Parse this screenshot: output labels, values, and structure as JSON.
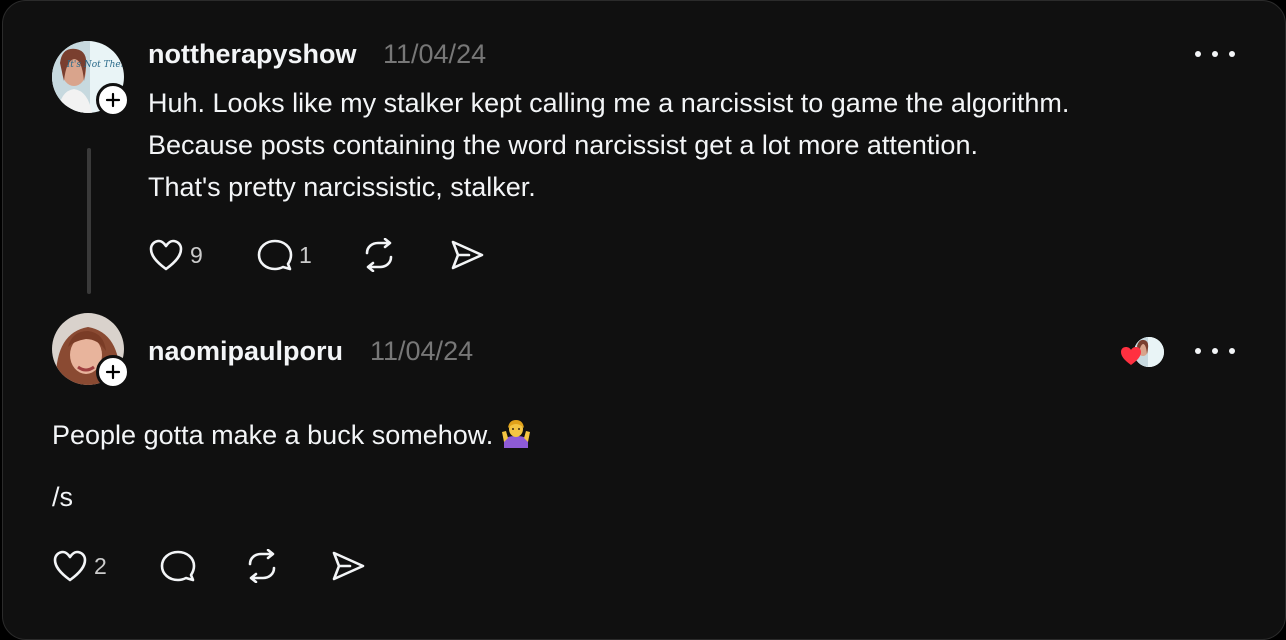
{
  "posts": [
    {
      "username": "nottherapyshow",
      "date": "11/04/24",
      "lines": [
        "Huh. Looks like my stalker kept calling me a narcissist to game the algorithm.",
        "Because posts containing the word narcissist get a lot more attention.",
        "That's pretty narcissistic, stalker."
      ],
      "likes": "9",
      "replies": "1",
      "avatar_logo_text": "It's Not Therapy"
    },
    {
      "username": "naomipaulporu",
      "date": "11/04/24",
      "lines": [
        "People gotta make a buck somehow.",
        "/s"
      ],
      "emoji": "🤷‍♀️",
      "likes": "2",
      "replies": ""
    }
  ],
  "icons": {
    "like": "heart-icon",
    "reply": "comment-bubble-icon",
    "repost": "repost-icon",
    "share": "send-icon",
    "follow": "plus-icon",
    "more": "ellipsis-icon"
  },
  "colors": {
    "background": "#101010",
    "text": "#f3f5f7",
    "muted": "#777777",
    "like_heart": "#ff3040"
  }
}
